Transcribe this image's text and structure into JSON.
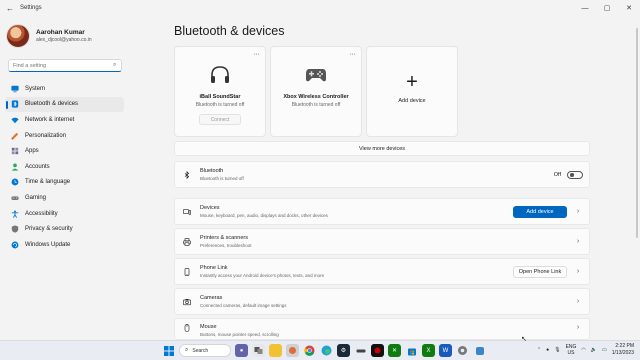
{
  "window": {
    "title": "Settings",
    "controls": [
      "—",
      "▢",
      "✕"
    ]
  },
  "profile": {
    "name": "Aarohan Kumar",
    "email": "alex_djcool@yahoo.co.in"
  },
  "search": {
    "placeholder": "Find a setting"
  },
  "sidebar": {
    "items": [
      {
        "label": "System",
        "icon": "monitor-icon",
        "color": "#0078d4"
      },
      {
        "label": "Bluetooth & devices",
        "icon": "bluetooth-icon",
        "color": "#0078d4",
        "active": true
      },
      {
        "label": "Network & internet",
        "icon": "wifi-icon",
        "color": "#0078d4"
      },
      {
        "label": "Personalization",
        "icon": "brush-icon",
        "color": "#e07a2f"
      },
      {
        "label": "Apps",
        "icon": "apps-icon",
        "color": "#6b6b8a"
      },
      {
        "label": "Accounts",
        "icon": "person-icon",
        "color": "#2eaa5c"
      },
      {
        "label": "Time & language",
        "icon": "globe-clock-icon",
        "color": "#0078d4"
      },
      {
        "label": "Gaming",
        "icon": "gamepad-icon",
        "color": "#777"
      },
      {
        "label": "Accessibility",
        "icon": "accessibility-icon",
        "color": "#0078d4"
      },
      {
        "label": "Privacy & security",
        "icon": "shield-icon",
        "color": "#777"
      },
      {
        "label": "Windows Update",
        "icon": "update-icon",
        "color": "#0078d4"
      }
    ]
  },
  "main": {
    "title": "Bluetooth & devices",
    "device_cards": [
      {
        "name": "iBall SoundStar",
        "status": "Bluetooth is turned off",
        "button": "Connect",
        "icon": "headphones-icon"
      },
      {
        "name": "Xbox Wireless Controller",
        "status": "Bluetooth is turned off",
        "icon": "controller-icon"
      }
    ],
    "add_card": {
      "label": "Add device"
    },
    "view_more": "View more devices",
    "bluetooth_row": {
      "title": "Bluetooth",
      "subtitle": "Bluetooth is turned off",
      "toggle_label": "Off"
    },
    "rows": [
      {
        "title": "Devices",
        "subtitle": "Mouse, keyboard, pen, audio, displays and docks, other devices",
        "button": "Add device",
        "icon": "devices-icon"
      },
      {
        "title": "Printers & scanners",
        "subtitle": "Preferences, troubleshoot",
        "icon": "printer-icon"
      },
      {
        "title": "Phone Link",
        "subtitle": "Instantly access your Android device's photos, texts, and more",
        "button": "Open Phone Link",
        "icon": "phone-icon"
      },
      {
        "title": "Cameras",
        "subtitle": "Connected cameras, default image settings",
        "icon": "camera-icon"
      },
      {
        "title": "Mouse",
        "subtitle": "Buttons, mouse pointer speed, scrolling",
        "icon": "mouse-icon"
      }
    ]
  },
  "taskbar": {
    "search_label": "Search",
    "lang": "ENG",
    "region": "US",
    "time": "2:22 PM",
    "date": "1/13/2023"
  }
}
